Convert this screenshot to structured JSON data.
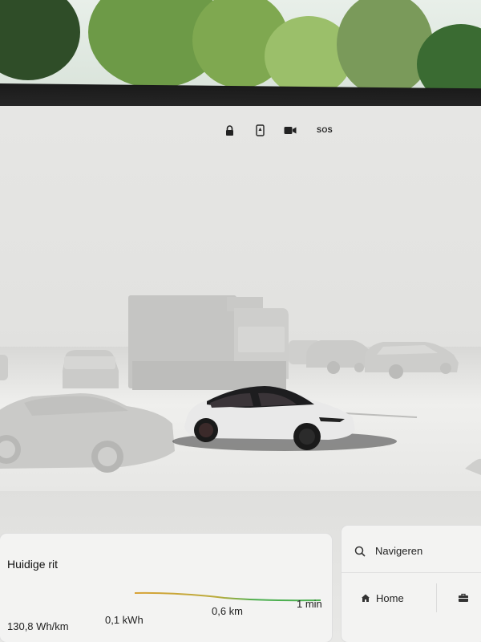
{
  "status_bar": {
    "icons": [
      "lock-icon",
      "phone-key-icon",
      "dashcam-icon",
      "sos-icon"
    ],
    "sos_label": "SOS"
  },
  "trip": {
    "title": "Huidige rit",
    "efficiency_value": "130,8",
    "efficiency_unit": "Wh/km",
    "energy": "0,1 kWh",
    "distance": "0,6 km",
    "duration": "1 min"
  },
  "navigation": {
    "search_label": "Navigeren",
    "home_label": "Home"
  },
  "colors": {
    "ego_car": "#e9e9e9",
    "other_vehicles": "#c9c9c7",
    "trip_line_start": "#d8a236",
    "trip_line_end": "#4caf50"
  }
}
